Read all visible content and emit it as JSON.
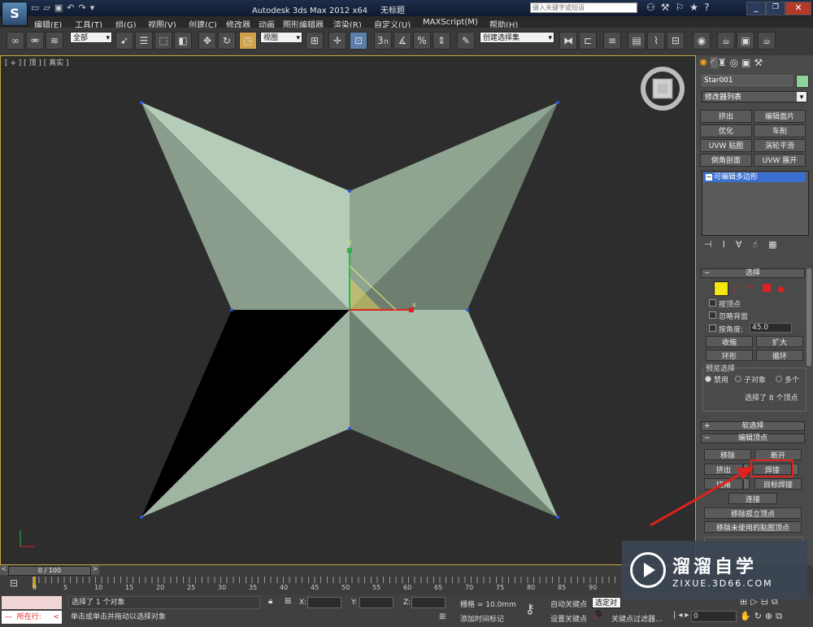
{
  "title": {
    "app": "Autodesk 3ds Max  2012 x64",
    "doc": "无标题",
    "search_placeholder": "键入关键字或短语"
  },
  "menu": [
    "编辑(E)",
    "工具(T)",
    "组(G)",
    "视图(V)",
    "创建(C)",
    "修改器",
    "动画",
    "图形编辑器",
    "渲染(R)",
    "自定义(U)",
    "MAXScript(M)",
    "帮助(H)"
  ],
  "toolbar": {
    "selection_filter": "全部",
    "reference_coord": "视图",
    "named_selection": "创建选择集",
    "snap_label": "3"
  },
  "viewport": {
    "label": "[ + ] [ 顶 ] [ 真实 ]",
    "axis_x": "x",
    "axis_y": "y"
  },
  "command_panel": {
    "object_name": "Star001",
    "object_color": "#8fd19a",
    "modifier_list": "修改器列表",
    "modifier_buttons": [
      "挤出",
      "编辑面片",
      "优化",
      "车削",
      "UVW 贴图",
      "涡轮平滑",
      "倒角剖面",
      "UVW 展开"
    ],
    "stack_item": "可编辑多边形",
    "selection": {
      "header": "选择",
      "by_vertex": "按顶点",
      "ignore_backfacing": "忽略背面",
      "by_angle": "按角度:",
      "angle_value": "45.0",
      "shrink": "收缩",
      "grow": "扩大",
      "ring": "环形",
      "loop": "循环",
      "preview_label": "预览选择",
      "preview_off": "禁用",
      "preview_sub": "子对象",
      "preview_multi": "多个",
      "status": "选择了 8 个顶点"
    },
    "soft_selection": "软选择",
    "edit_vertices": {
      "header": "编辑顶点",
      "remove": "移除",
      "break": "断开",
      "extrude": "挤出",
      "weld": "焊接",
      "chamfer": "切角",
      "target_weld": "目标焊接",
      "connect": "连接",
      "remove_isolated": "移除孤立顶点",
      "remove_unused_map": "移除未使用的贴图顶点"
    }
  },
  "timeline": {
    "frame": "0 / 100",
    "ticks": [
      "0",
      "5",
      "10",
      "15",
      "20",
      "25",
      "30",
      "35",
      "40",
      "45",
      "50",
      "55",
      "60",
      "65",
      "70",
      "75",
      "80",
      "85",
      "90"
    ]
  },
  "status": {
    "mode": "所在行:",
    "line1": "选择了 1 个对象",
    "line2": "单击或单击并拖动以选择对象",
    "x_label": "X:",
    "y_label": "Y:",
    "z_label": "Z:",
    "grid": "栅格 = 10.0mm",
    "add_time_tag": "添加时间标记",
    "auto_key": "自动关键点",
    "set_key": "设置关键点",
    "selected_object": "选定对象",
    "key_filters": "关键点过滤器...",
    "frame_value": "0"
  },
  "watermark": {
    "name": "溜溜自学",
    "url": "ZIXUE.3D66.COM"
  },
  "annotation_color": "#e0211d"
}
